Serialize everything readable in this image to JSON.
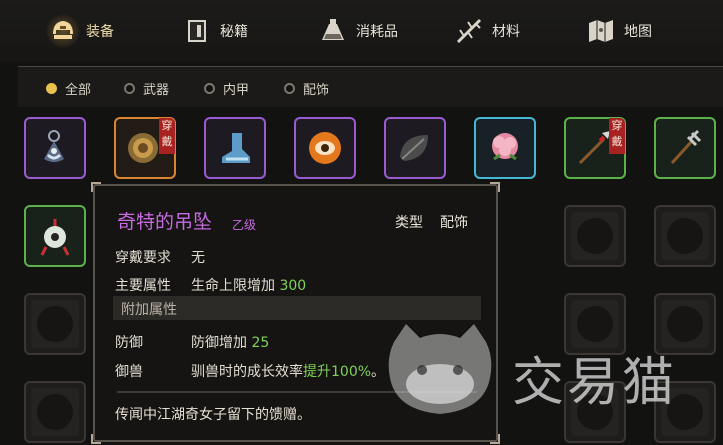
{
  "tabs": [
    {
      "label": "装备",
      "icon": "helmet-icon",
      "active": true
    },
    {
      "label": "秘籍",
      "icon": "book-icon",
      "active": false
    },
    {
      "label": "消耗品",
      "icon": "potion-icon",
      "active": false
    },
    {
      "label": "材料",
      "icon": "branch-icon",
      "active": false
    },
    {
      "label": "地图",
      "icon": "map-icon",
      "active": false
    }
  ],
  "filters": [
    {
      "label": "全部",
      "active": true
    },
    {
      "label": "武器",
      "active": false
    },
    {
      "label": "内甲",
      "active": false
    },
    {
      "label": "配饰",
      "active": false
    }
  ],
  "slots_row1": [
    {
      "icon": "pendant-icon",
      "border": "purple"
    },
    {
      "icon": "round-shield-icon",
      "border": "orange",
      "tag": "穿戴"
    },
    {
      "icon": "blue-boot-icon",
      "border": "purple"
    },
    {
      "icon": "eye-orb-icon",
      "border": "purple"
    },
    {
      "icon": "dark-leaf-icon",
      "border": "purple"
    },
    {
      "icon": "peony-flower-icon",
      "border": "blue"
    },
    {
      "icon": "spear-icon",
      "border": "green",
      "tag": "穿戴"
    },
    {
      "icon": "trident-icon",
      "border": "green"
    }
  ],
  "slots_row2_first": {
    "icon": "jade-pendant-icon",
    "border": "green"
  },
  "tooltip": {
    "name": "奇特的吊坠",
    "grade": "乙级",
    "type_label": "类型",
    "type_value": "配饰",
    "requirement_label": "穿戴要求",
    "requirement_value": "无",
    "main_attr_label": "主要属性",
    "main_attr_text": "生命上限增加",
    "main_attr_value": "300",
    "extra_header": "附加属性",
    "extra": [
      {
        "label": "防御",
        "text": "防御增加",
        "value": "25",
        "suffix": ""
      },
      {
        "label": "御兽",
        "text": "驯兽时的成长效率",
        "value": "提升100%",
        "suffix": "。"
      }
    ],
    "description": "传闻中江湖奇女子留下的馈赠。"
  },
  "watermark": {
    "text": "交易猫",
    "icon": "cat-logo-icon"
  },
  "colors": {
    "accent": "#e9c24f",
    "purple_rarity": "#9a5ad1",
    "orange_rarity": "#d98534",
    "blue_rarity": "#46b6d6",
    "green_rarity": "#5db14a",
    "value_green": "#7fd15a"
  }
}
